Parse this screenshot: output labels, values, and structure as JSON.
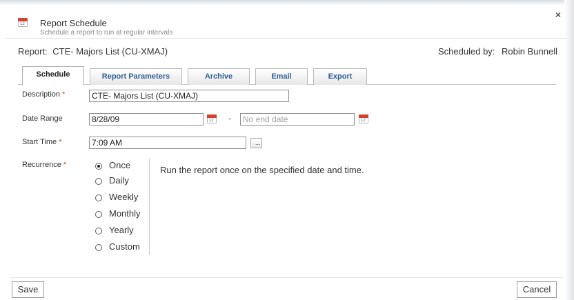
{
  "header": {
    "title": "Report Schedule",
    "subtitle": "Schedule a report to run at regular intervals",
    "icon": "calendar-icon",
    "icon_day": "12",
    "close_icon": "close-icon",
    "close_glyph": "×"
  },
  "report": {
    "label": "Report:",
    "name": "CTE- Majors List (CU-XMAJ)",
    "scheduled_by_label": "Scheduled by:",
    "scheduled_by": "Robin Bunnell"
  },
  "tabs": [
    {
      "label": "Schedule",
      "active": true
    },
    {
      "label": "Report Parameters",
      "active": false
    },
    {
      "label": "Archive",
      "active": false
    },
    {
      "label": "Email",
      "active": false
    },
    {
      "label": "Export",
      "active": false
    }
  ],
  "form": {
    "description": {
      "label": "Description",
      "required": "*",
      "value": "CTE- Majors List (CU-XMAJ)"
    },
    "date_range": {
      "label": "Date Range",
      "start_value": "8/28/09",
      "separator": "-",
      "end_placeholder": "No end date"
    },
    "start_time": {
      "label": "Start Time",
      "required": "*",
      "value": "7:09 AM",
      "picker_label": "..."
    },
    "recurrence": {
      "label": "Recurrence",
      "required": "*",
      "options": [
        "Once",
        "Daily",
        "Weekly",
        "Monthly",
        "Yearly",
        "Custom"
      ],
      "selected": "Once",
      "description": "Run the report once on the specified date and time."
    }
  },
  "footer": {
    "save_label": "Save",
    "cancel_label": "Cancel"
  },
  "colors": {
    "required": "#d6402f",
    "tab_text": "#2f5f95",
    "calendar_accent": "#d6402f"
  }
}
